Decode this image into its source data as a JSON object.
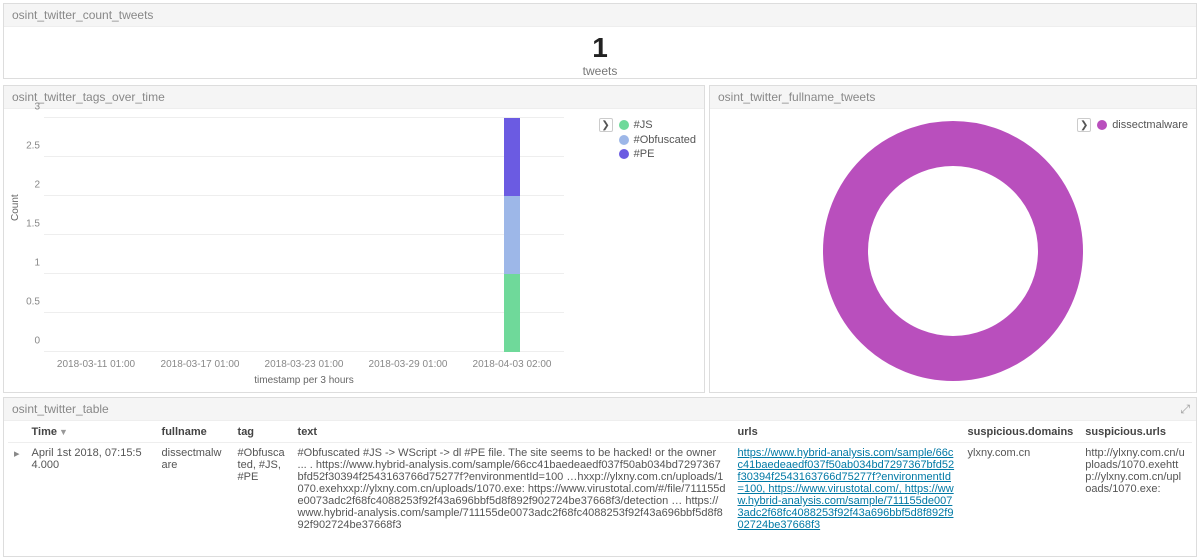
{
  "count_panel": {
    "title": "osint_twitter_count_tweets",
    "value": "1",
    "label": "tweets"
  },
  "tags_panel": {
    "title": "osint_twitter_tags_over_time",
    "y_label": "Count",
    "x_label": "timestamp per 3 hours",
    "x_ticks": [
      "2018-03-11 01:00",
      "2018-03-17 01:00",
      "2018-03-23 01:00",
      "2018-03-29 01:00",
      "2018-04-03 02:00"
    ],
    "y_ticks": [
      "0",
      "0.5",
      "1",
      "1.5",
      "2",
      "2.5",
      "3"
    ],
    "legend_toggle": "❯",
    "legend": [
      "#JS",
      "#Obfuscated",
      "#PE"
    ]
  },
  "pie_panel": {
    "title": "osint_twitter_fullname_tweets",
    "legend_toggle": "❯",
    "legend": [
      "dissectmalware"
    ]
  },
  "table_panel": {
    "title": "osint_twitter_table",
    "columns": [
      "Time",
      "fullname",
      "tag",
      "text",
      "urls",
      "suspicious.domains",
      "suspicious.urls"
    ],
    "row_toggle": "▸",
    "rows": [
      {
        "time": "April 1st 2018, 07:15:54.000",
        "fullname": "dissectmalware",
        "tag": "#Obfuscated, #JS, #PE",
        "text": "#Obfuscated #JS -> WScript -> dl #PE file. The site seems to be hacked! or the owner ... . https://www.hybrid-analysis.com/sample/66cc41baedeaedf037f50ab034bd7297367bfd52f30394f2543163766d75277f?environmentId=100 …hxxp://ylxny.com.cn/uploads/1070.exehxxp://ylxny.com.cn/uploads/1070.exe: https://www.virustotal.com/#/file/711155de0073adc2f68fc4088253f92f43a696bbf5d8f892f902724be37668f3/detection … https://www.hybrid-analysis.com/sample/711155de0073adc2f68fc4088253f92f43a696bbf5d8f892f902724be37668f3",
        "urls": "https://www.hybrid-analysis.com/sample/66cc41baedeaedf037f50ab034bd7297367bfd52f30394f2543163766d75277f?environmentId=100, https://www.virustotal.com/, https://www.hybrid-analysis.com/sample/711155de0073adc2f68fc4088253f92f43a696bbf5d8f892f902724be37668f3",
        "susp_domains": "ylxny.com.cn",
        "susp_urls": "http://ylxny.com.cn/uploads/1070.exehttp://ylxny.com.cn/uploads/1070.exe:"
      }
    ]
  },
  "colors": {
    "js": "#6fd99a",
    "obf": "#9db7e8",
    "pe": "#6b5be2",
    "pie": "#b94fbd"
  },
  "chart_data": [
    {
      "type": "bar",
      "title": "osint_twitter_tags_over_time",
      "xlabel": "timestamp per 3 hours",
      "ylabel": "Count",
      "ylim": [
        0,
        3
      ],
      "categories": [
        "2018-03-11 01:00",
        "2018-03-17 01:00",
        "2018-03-23 01:00",
        "2018-03-29 01:00",
        "2018-04-03 02:00"
      ],
      "stacked": true,
      "series": [
        {
          "name": "#JS",
          "values": [
            0,
            0,
            0,
            0,
            1
          ]
        },
        {
          "name": "#Obfuscated",
          "values": [
            0,
            0,
            0,
            0,
            1
          ]
        },
        {
          "name": "#PE",
          "values": [
            0,
            0,
            0,
            0,
            1
          ]
        }
      ]
    },
    {
      "type": "pie",
      "title": "osint_twitter_fullname_tweets",
      "series": [
        {
          "name": "dissectmalware",
          "value": 1
        }
      ]
    }
  ]
}
